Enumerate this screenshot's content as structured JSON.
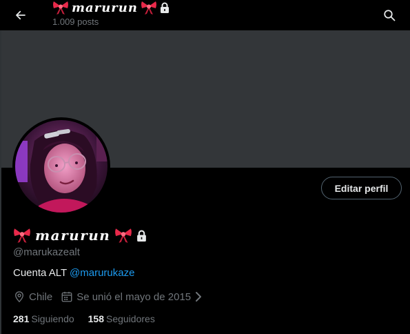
{
  "header": {
    "display_name": "marurun",
    "posts_count": "1.009 posts"
  },
  "profile": {
    "display_name": "marurun",
    "handle": "@marukazealt",
    "bio_text": "Cuenta ALT ",
    "bio_mention": "@marurukaze",
    "location": "Chile",
    "joined": "Se unió el mayo de 2015",
    "following_count": "281",
    "following_label": "Siguiendo",
    "followers_count": "158",
    "followers_label": "Seguidores"
  },
  "actions": {
    "edit_profile_label": "Editar perfil"
  },
  "icons": {
    "back": "arrow-left-icon",
    "search": "search-icon",
    "ribbon": "ribbon-bow-icon",
    "lock": "lock-icon",
    "location": "location-pin-icon",
    "calendar": "calendar-icon",
    "chevron": "chevron-right-icon"
  },
  "colors": {
    "background": "#000000",
    "banner": "#333639",
    "text": "#e7e9ea",
    "secondary_text": "#71767b",
    "link": "#1d9bf0",
    "ribbon": "#e8294a"
  }
}
